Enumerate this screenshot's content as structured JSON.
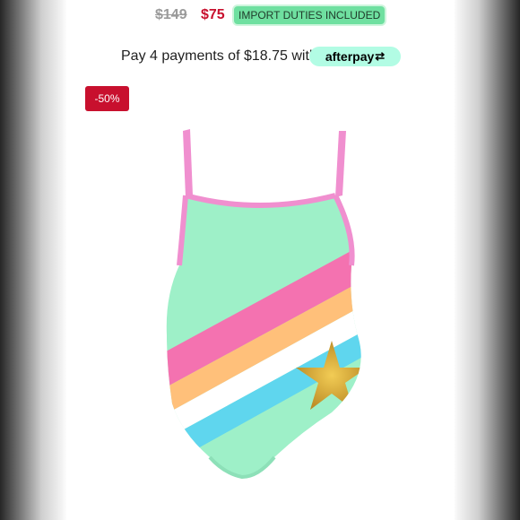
{
  "price": {
    "original": "$149",
    "sale": "$75",
    "duties_badge": "IMPORT DUTIES INCLUDED"
  },
  "payment": {
    "text": "Pay 4 payments of $18.75 with",
    "provider": "afterpay",
    "provider_icon": "afterpay-arrows-icon",
    "provider_color": "#b2fce4"
  },
  "badge": {
    "discount": "-50%",
    "color": "#c8102e"
  },
  "product": {
    "image": "rainbow striped swimsuit with gold star",
    "colors": {
      "body": "#9ef0c8",
      "trim": "#f08fcf",
      "pink": "#f472b0",
      "peach": "#ffc07a",
      "white": "#ffffff",
      "blue": "#5fd6ee",
      "star": "#d8a834"
    }
  }
}
